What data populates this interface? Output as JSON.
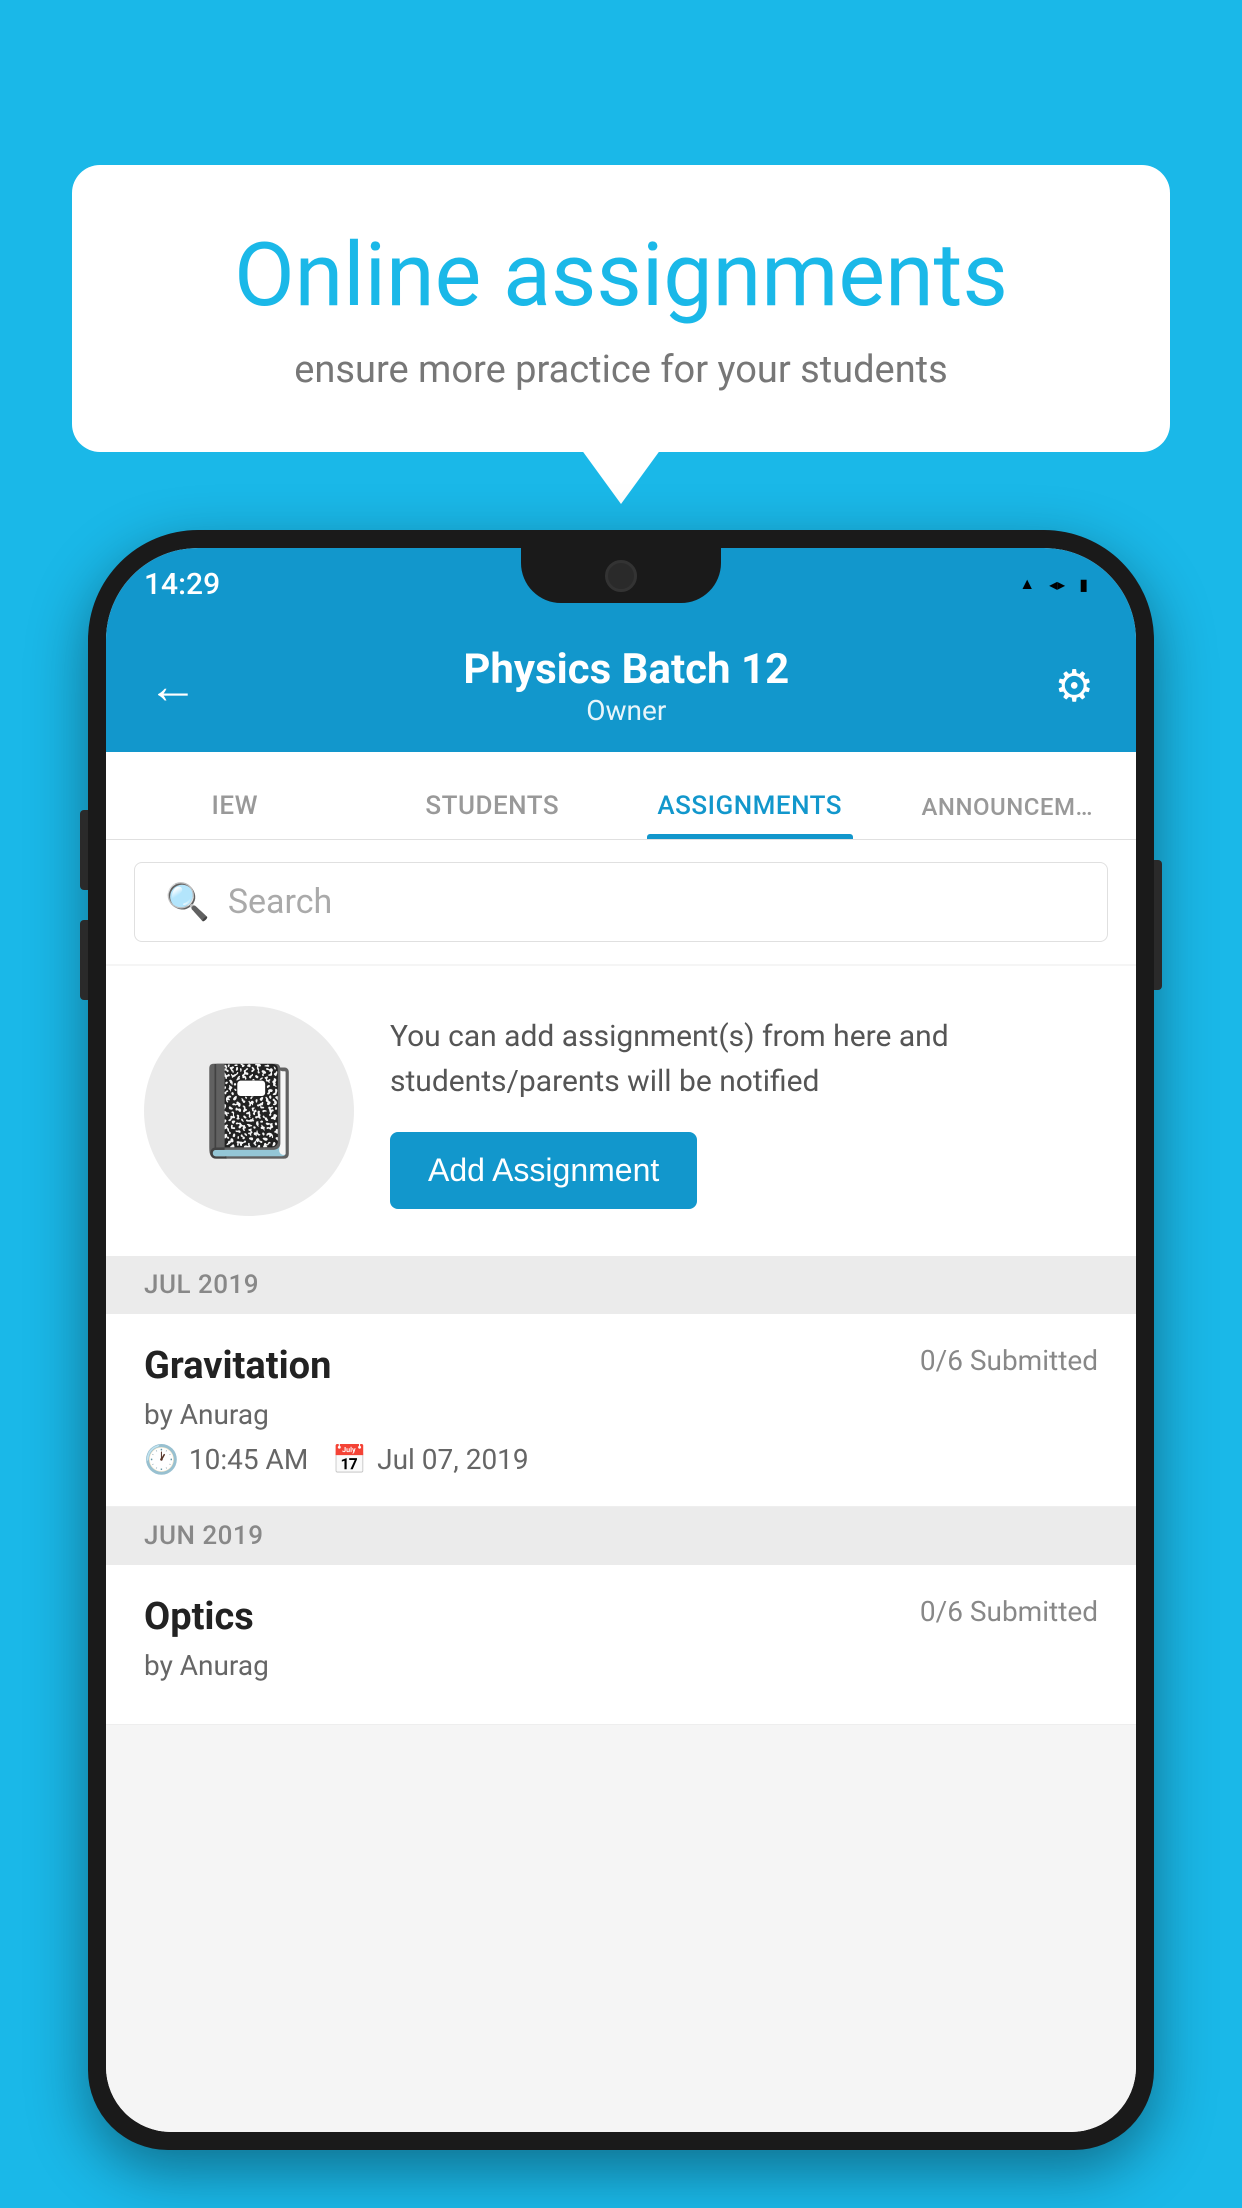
{
  "background_color": "#1ab8e8",
  "speech_bubble": {
    "title": "Online assignments",
    "subtitle": "ensure more practice for your students"
  },
  "status_bar": {
    "time": "14:29",
    "icons": [
      "wifi",
      "signal",
      "battery"
    ]
  },
  "header": {
    "title": "Physics Batch 12",
    "subtitle": "Owner",
    "back_label": "←",
    "settings_label": "⚙"
  },
  "tabs": [
    {
      "label": "IEW",
      "active": false
    },
    {
      "label": "STUDENTS",
      "active": false
    },
    {
      "label": "ASSIGNMENTS",
      "active": true
    },
    {
      "label": "ANNOUNCEM…",
      "active": false
    }
  ],
  "search": {
    "placeholder": "Search"
  },
  "promo": {
    "text": "You can add assignment(s) from here and students/parents will be notified",
    "button_label": "Add Assignment"
  },
  "months": [
    {
      "label": "JUL 2019",
      "assignments": [
        {
          "name": "Gravitation",
          "submitted": "0/6 Submitted",
          "author": "by Anurag",
          "time": "10:45 AM",
          "date": "Jul 07, 2019"
        }
      ]
    },
    {
      "label": "JUN 2019",
      "assignments": [
        {
          "name": "Optics",
          "submitted": "0/6 Submitted",
          "author": "by Anurag",
          "time": "",
          "date": ""
        }
      ]
    }
  ],
  "icons": {
    "search": "🔍",
    "notebook": "📓",
    "clock": "🕐",
    "calendar": "📅",
    "back_arrow": "←",
    "settings_gear": "⚙"
  }
}
